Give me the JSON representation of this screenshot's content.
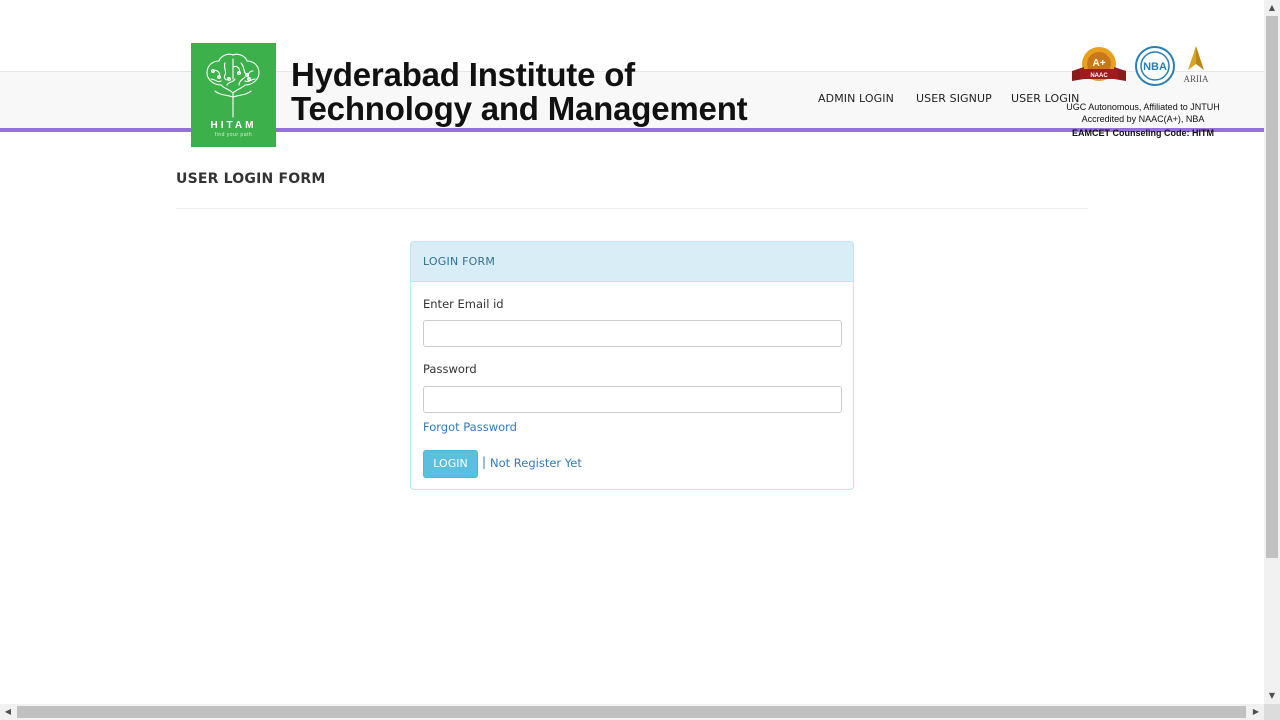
{
  "brand": {
    "logo_text": "HITAM",
    "logo_tagline": "find your path",
    "name_line1": "Hyderabad Institute of",
    "name_line2": "Technology and Management",
    "logo_color": "#3cb04a"
  },
  "nav": {
    "items": [
      {
        "label": "ADMIN LOGIN"
      },
      {
        "label": "USER SIGNUP"
      },
      {
        "label": "USER LOGIN"
      }
    ],
    "accent_line_color": "#9370db"
  },
  "badges": {
    "naac": "A+",
    "naac_sub": "NAAC",
    "nba": "NBA",
    "ariia": "ARIIA"
  },
  "accreditation": {
    "line1": "UGC Autonomous, Affiliated to JNTUH",
    "line2": "Accredited by NAAC(A+), NBA",
    "line3": "EAMCET Counseling Code: HITM"
  },
  "page": {
    "title": "USER LOGIN FORM"
  },
  "form": {
    "heading": "LOGIN FORM",
    "email_label": "Enter Email id",
    "email_value": "",
    "password_label": "Password",
    "password_value": "",
    "forgot_link": "Forgot Password",
    "login_button": "LOGIN",
    "separator": "|",
    "register_link": "Not Register Yet",
    "heading_bg": "#d9edf7",
    "button_color": "#5bc0de",
    "link_color": "#337ab7"
  },
  "scrollbar": {
    "up_arrow": "▲",
    "down_arrow": "▼",
    "left_arrow": "◀",
    "right_arrow": "▶"
  }
}
